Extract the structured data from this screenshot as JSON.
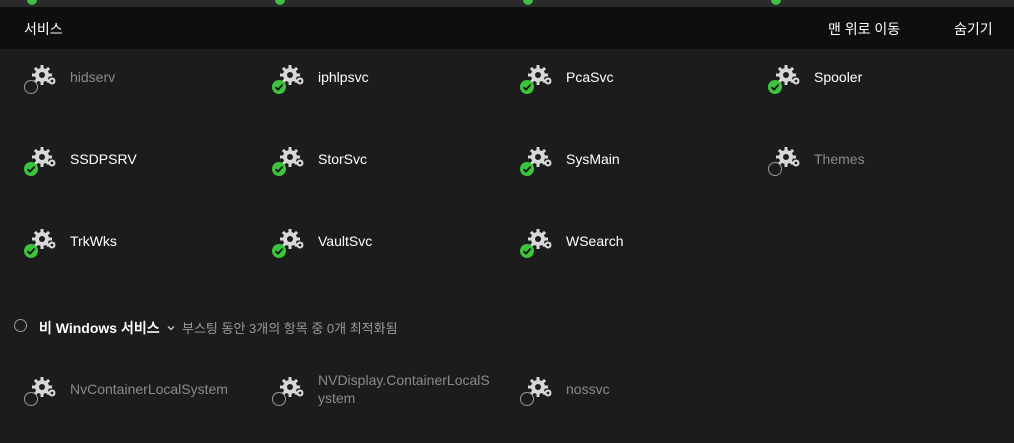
{
  "header": {
    "title": "서비스",
    "scroll_top_label": "맨 위로 이동",
    "hide_label": "숨기기"
  },
  "services": [
    {
      "name": "hidserv",
      "enabled": false
    },
    {
      "name": "iphlpsvc",
      "enabled": true
    },
    {
      "name": "PcaSvc",
      "enabled": true
    },
    {
      "name": "Spooler",
      "enabled": true
    },
    {
      "name": "SSDPSRV",
      "enabled": true
    },
    {
      "name": "StorSvc",
      "enabled": true
    },
    {
      "name": "SysMain",
      "enabled": true
    },
    {
      "name": "Themes",
      "enabled": false
    },
    {
      "name": "TrkWks",
      "enabled": true
    },
    {
      "name": "VaultSvc",
      "enabled": true
    },
    {
      "name": "WSearch",
      "enabled": true
    }
  ],
  "non_windows_section": {
    "title": "비 Windows 서비스",
    "status": "부스팅 동안 3개의 항목 중 0개 최적화됨",
    "services": [
      {
        "name": "NvContainerLocalSystem",
        "enabled": false
      },
      {
        "name": "NVDisplay.ContainerLocalSystem",
        "name_line1": "NVDisplay.ContainerLocalS",
        "name_line2": "ystem",
        "enabled": false
      },
      {
        "name": "nossvc",
        "enabled": false
      }
    ]
  },
  "colors": {
    "background": "#1c1c1c",
    "header_bg": "#0e0e0e",
    "enabled_badge": "#3cc43c",
    "disabled_text": "#8a8a8a"
  },
  "icons": {
    "service": "gear-icon",
    "enabled": "check-circle-icon",
    "disabled": "empty-circle-icon",
    "expand": "chevron-down-icon"
  }
}
